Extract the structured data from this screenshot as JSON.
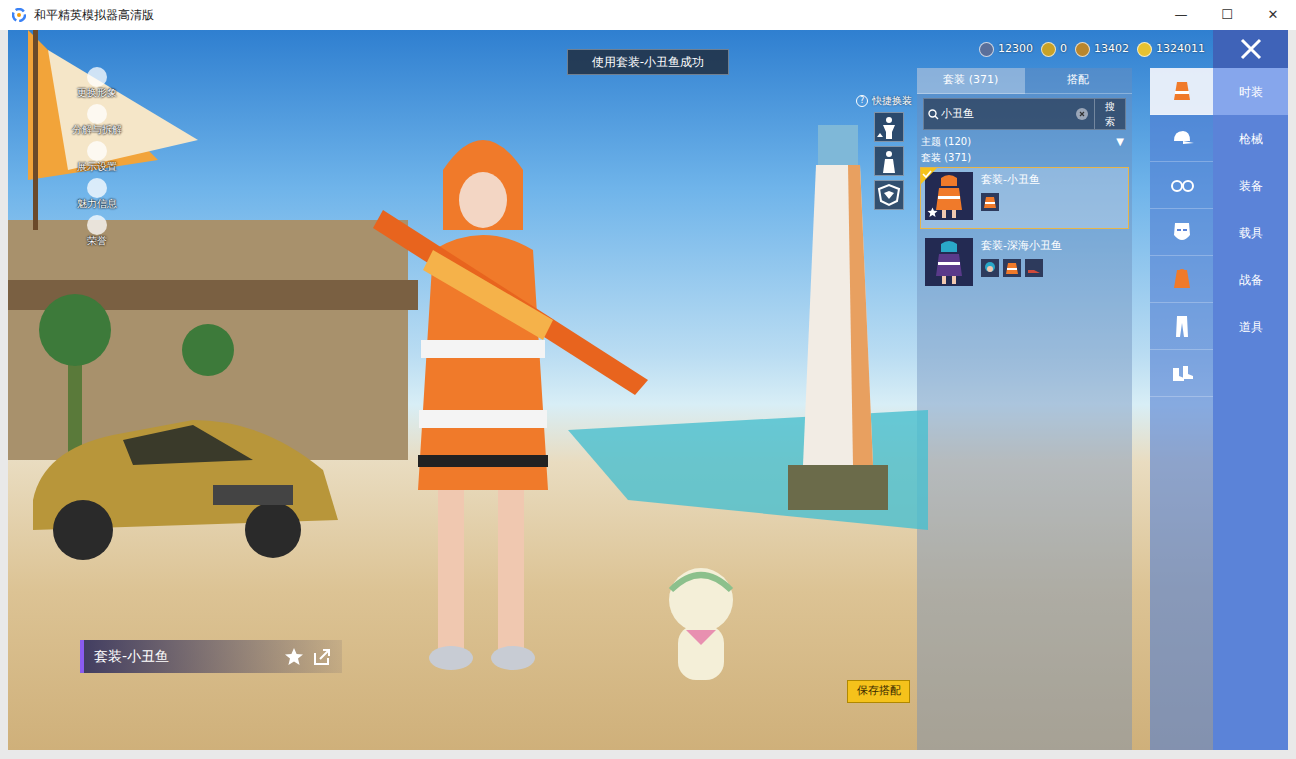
{
  "window": {
    "title": "和平精英模拟器高清版",
    "controls": [
      "—",
      "☐",
      "✕"
    ]
  },
  "toast": "使用套装-小丑鱼成功",
  "currencies": [
    {
      "amount": "12300",
      "kind": "gem"
    },
    {
      "amount": "0",
      "kind": "token"
    },
    {
      "amount": "13402",
      "kind": "coin"
    },
    {
      "amount": "1324011",
      "kind": "gold"
    }
  ],
  "side_menu": [
    {
      "label": "更换形象"
    },
    {
      "label": "分解与拆解"
    },
    {
      "label": "展示设置"
    },
    {
      "label": "魅力信息"
    },
    {
      "label": "荣誉"
    }
  ],
  "quick_change": {
    "label": "快捷换装",
    "help": "?"
  },
  "panel": {
    "tabs": [
      {
        "label": "套装 (371)",
        "selected": true
      },
      {
        "label": "搭配",
        "selected": false
      }
    ],
    "search": {
      "value": "小丑鱼",
      "button": "搜索"
    },
    "filter": {
      "label": "主题 (120)",
      "arrow": "▼"
    },
    "section": "套装 (371)",
    "items": [
      {
        "name": "套装-小丑鱼",
        "selected": true,
        "equipped": true,
        "favorite": true,
        "parts": [
          {
            "kind": "outfit"
          }
        ]
      },
      {
        "name": "套装-深海小丑鱼",
        "selected": false,
        "equipped": false,
        "favorite": false,
        "parts": [
          {
            "kind": "hair"
          },
          {
            "kind": "outfit"
          },
          {
            "kind": "shoes"
          }
        ]
      }
    ]
  },
  "categories": [
    {
      "selected": true
    },
    {
      "selected": false
    },
    {
      "selected": false
    },
    {
      "selected": false
    },
    {
      "selected": false
    },
    {
      "selected": false
    },
    {
      "selected": false
    }
  ],
  "nav": [
    {
      "label": "时装",
      "selected": true
    },
    {
      "label": "枪械",
      "selected": false
    },
    {
      "label": "装备",
      "selected": false
    },
    {
      "label": "载具",
      "selected": false
    },
    {
      "label": "战备",
      "selected": false
    },
    {
      "label": "道具",
      "selected": false
    }
  ],
  "outfit_label": "套装-小丑鱼",
  "save_button": "保存搭配"
}
